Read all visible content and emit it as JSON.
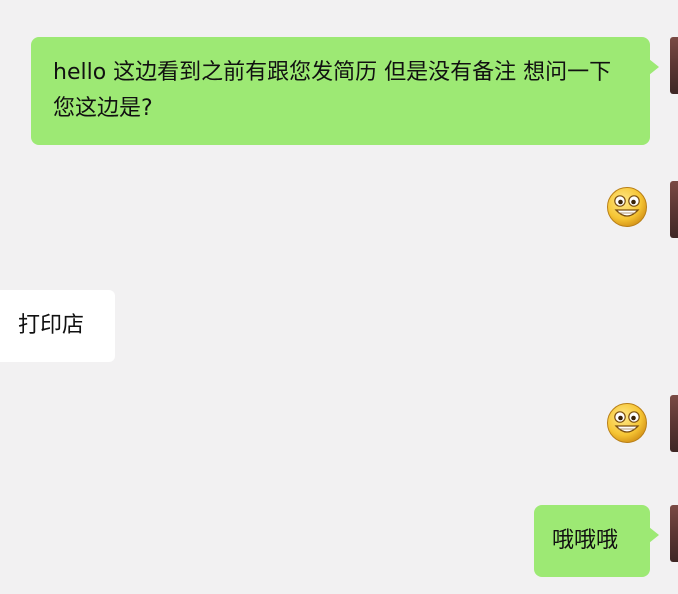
{
  "conversation": {
    "messages": [
      {
        "side": "sent",
        "type": "text",
        "text": "hello 这边看到之前有跟您发简历 但是没有备注 想问一下您这边是?"
      },
      {
        "side": "sent",
        "type": "emoji",
        "icon": "grinning-emoji-icon"
      },
      {
        "side": "received",
        "type": "text",
        "text": "打印店"
      },
      {
        "side": "sent",
        "type": "emoji",
        "icon": "grinning-emoji-icon"
      },
      {
        "side": "sent",
        "type": "text",
        "text": "哦哦哦"
      }
    ]
  },
  "colors": {
    "background": "#f2f1f2",
    "sent_bubble": "#9de974",
    "received_bubble": "#ffffff"
  }
}
